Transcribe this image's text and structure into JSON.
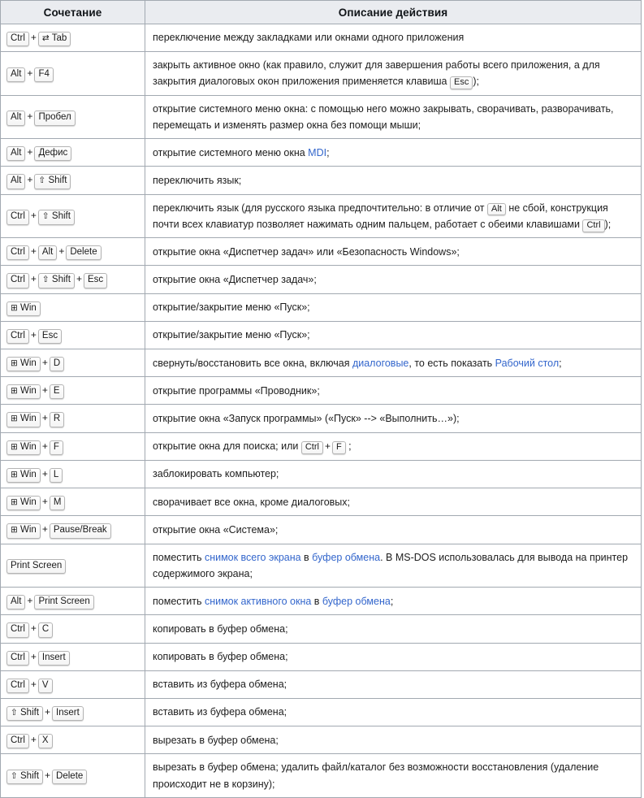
{
  "table": {
    "headers": {
      "combo": "Сочетание",
      "description": "Описание действия"
    },
    "colors": {
      "header_bg": "#eaecf0",
      "border": "#a2a9b1",
      "link": "#3366cc",
      "key_bg": "#fcfcfc",
      "text": "#1a1a1a"
    },
    "rows": [
      {
        "keys": [
          {
            "type": "kbd",
            "label": "Ctrl"
          },
          {
            "type": "plus",
            "label": "+"
          },
          {
            "type": "kbd",
            "label": "Tab",
            "glyph": "⇄"
          }
        ],
        "desc_parts": [
          {
            "type": "text",
            "text": "переключение между закладками или окнами одного приложения"
          }
        ]
      },
      {
        "keys": [
          {
            "type": "kbd",
            "label": "Alt"
          },
          {
            "type": "plus",
            "label": "+"
          },
          {
            "type": "kbd",
            "label": "F4"
          }
        ],
        "desc_parts": [
          {
            "type": "text",
            "text": "закрыть активное окно (как правило, служит для завершения работы всего приложения, а для закрытия диалоговых окон приложения применяется клавиша "
          },
          {
            "type": "kbd",
            "label": "Esc"
          },
          {
            "type": "text",
            "text": ");"
          }
        ]
      },
      {
        "keys": [
          {
            "type": "kbd",
            "label": "Alt"
          },
          {
            "type": "plus",
            "label": "+"
          },
          {
            "type": "kbd",
            "label": "Пробел"
          }
        ],
        "desc_parts": [
          {
            "type": "text",
            "text": "открытие системного меню окна: с помощью него можно закрывать, сворачивать, разворачивать, перемещать и изменять размер окна без помощи мыши;"
          }
        ]
      },
      {
        "keys": [
          {
            "type": "kbd",
            "label": "Alt"
          },
          {
            "type": "plus",
            "label": "+"
          },
          {
            "type": "kbd",
            "label": "Дефис"
          }
        ],
        "desc_parts": [
          {
            "type": "text",
            "text": "открытие системного меню окна "
          },
          {
            "type": "link",
            "text": "MDI"
          },
          {
            "type": "text",
            "text": ";"
          }
        ]
      },
      {
        "keys": [
          {
            "type": "kbd",
            "label": "Alt"
          },
          {
            "type": "plus",
            "label": "+"
          },
          {
            "type": "kbd",
            "label": "Shift",
            "glyph": "⇧"
          }
        ],
        "desc_parts": [
          {
            "type": "text",
            "text": "переключить язык;"
          }
        ]
      },
      {
        "keys": [
          {
            "type": "kbd",
            "label": "Ctrl"
          },
          {
            "type": "plus",
            "label": "+"
          },
          {
            "type": "kbd",
            "label": "Shift",
            "glyph": "⇧"
          }
        ],
        "desc_parts": [
          {
            "type": "text",
            "text": "переключить язык (для русского языка предпочтительно: в отличие от "
          },
          {
            "type": "kbd",
            "label": "Alt"
          },
          {
            "type": "text",
            "text": " не сбой, конструкция почти всех клавиатур позволяет нажимать одним пальцем, работает с обеими клавишами "
          },
          {
            "type": "kbd",
            "label": "Ctrl"
          },
          {
            "type": "text",
            "text": ");"
          }
        ]
      },
      {
        "keys": [
          {
            "type": "kbd",
            "label": "Ctrl"
          },
          {
            "type": "plus",
            "label": "+"
          },
          {
            "type": "kbd",
            "label": "Alt"
          },
          {
            "type": "plus",
            "label": "+"
          },
          {
            "type": "kbd",
            "label": "Delete"
          }
        ],
        "desc_parts": [
          {
            "type": "text",
            "text": "открытие окна «Диспетчер задач» или «Безопасность Windows»;"
          }
        ]
      },
      {
        "keys": [
          {
            "type": "kbd",
            "label": "Ctrl"
          },
          {
            "type": "plus",
            "label": "+"
          },
          {
            "type": "kbd",
            "label": "Shift",
            "glyph": "⇧"
          },
          {
            "type": "plus",
            "label": "+"
          },
          {
            "type": "kbd",
            "label": "Esc"
          }
        ],
        "desc_parts": [
          {
            "type": "text",
            "text": "открытие окна «Диспетчер задач»;"
          }
        ]
      },
      {
        "keys": [
          {
            "type": "kbd",
            "label": "Win",
            "glyph": "⊞"
          }
        ],
        "desc_parts": [
          {
            "type": "text",
            "text": "открытие/закрытие меню «Пуск»;"
          }
        ]
      },
      {
        "keys": [
          {
            "type": "kbd",
            "label": "Ctrl"
          },
          {
            "type": "plus",
            "label": "+"
          },
          {
            "type": "kbd",
            "label": "Esc"
          }
        ],
        "desc_parts": [
          {
            "type": "text",
            "text": "открытие/закрытие меню «Пуск»;"
          }
        ]
      },
      {
        "keys": [
          {
            "type": "kbd",
            "label": "Win",
            "glyph": "⊞"
          },
          {
            "type": "plus",
            "label": "+"
          },
          {
            "type": "kbd",
            "label": "D"
          }
        ],
        "desc_parts": [
          {
            "type": "text",
            "text": "свернуть/восстановить все окна, включая "
          },
          {
            "type": "link",
            "text": "диалоговые"
          },
          {
            "type": "text",
            "text": ", то есть показать "
          },
          {
            "type": "link",
            "text": "Рабочий стол"
          },
          {
            "type": "text",
            "text": ";"
          }
        ]
      },
      {
        "keys": [
          {
            "type": "kbd",
            "label": "Win",
            "glyph": "⊞"
          },
          {
            "type": "plus",
            "label": "+"
          },
          {
            "type": "kbd",
            "label": "E"
          }
        ],
        "desc_parts": [
          {
            "type": "text",
            "text": "открытие программы «Проводник»;"
          }
        ]
      },
      {
        "keys": [
          {
            "type": "kbd",
            "label": "Win",
            "glyph": "⊞"
          },
          {
            "type": "plus",
            "label": "+"
          },
          {
            "type": "kbd",
            "label": "R"
          }
        ],
        "desc_parts": [
          {
            "type": "text",
            "text": "открытие окна «Запуск программы» («Пуск» --> «Выполнить…»);"
          }
        ]
      },
      {
        "keys": [
          {
            "type": "kbd",
            "label": "Win",
            "glyph": "⊞"
          },
          {
            "type": "plus",
            "label": "+"
          },
          {
            "type": "kbd",
            "label": "F"
          }
        ],
        "desc_parts": [
          {
            "type": "text",
            "text": "открытие окна для поиска; или "
          },
          {
            "type": "kbd",
            "label": "Ctrl"
          },
          {
            "type": "plustext",
            "text": "+"
          },
          {
            "type": "kbd",
            "label": "F"
          },
          {
            "type": "text",
            "text": " ;"
          }
        ]
      },
      {
        "keys": [
          {
            "type": "kbd",
            "label": "Win",
            "glyph": "⊞"
          },
          {
            "type": "plus",
            "label": "+"
          },
          {
            "type": "kbd",
            "label": "L"
          }
        ],
        "desc_parts": [
          {
            "type": "text",
            "text": "заблокировать компьютер;"
          }
        ]
      },
      {
        "keys": [
          {
            "type": "kbd",
            "label": "Win",
            "glyph": "⊞"
          },
          {
            "type": "plus",
            "label": "+"
          },
          {
            "type": "kbd",
            "label": "M"
          }
        ],
        "desc_parts": [
          {
            "type": "text",
            "text": "сворачивает все окна, кроме диалоговых;"
          }
        ]
      },
      {
        "keys": [
          {
            "type": "kbd",
            "label": "Win",
            "glyph": "⊞"
          },
          {
            "type": "plus",
            "label": "+"
          },
          {
            "type": "kbd",
            "label": "Pause/Break"
          }
        ],
        "desc_parts": [
          {
            "type": "text",
            "text": "открытие окна «Система»;"
          }
        ]
      },
      {
        "keys": [
          {
            "type": "kbd",
            "label": "Print Screen"
          }
        ],
        "desc_parts": [
          {
            "type": "text",
            "text": "поместить "
          },
          {
            "type": "link",
            "text": "снимок всего экрана"
          },
          {
            "type": "text",
            "text": " в "
          },
          {
            "type": "link",
            "text": "буфер обмена"
          },
          {
            "type": "text",
            "text": ". В MS-DOS использовалась для вывода на принтер содержимого экрана;"
          }
        ]
      },
      {
        "keys": [
          {
            "type": "kbd",
            "label": "Alt"
          },
          {
            "type": "plus",
            "label": "+"
          },
          {
            "type": "kbd",
            "label": "Print Screen"
          }
        ],
        "desc_parts": [
          {
            "type": "text",
            "text": "поместить "
          },
          {
            "type": "link",
            "text": "снимок активного окна"
          },
          {
            "type": "text",
            "text": " в "
          },
          {
            "type": "link",
            "text": "буфер обмена"
          },
          {
            "type": "text",
            "text": ";"
          }
        ]
      },
      {
        "keys": [
          {
            "type": "kbd",
            "label": "Ctrl"
          },
          {
            "type": "plus",
            "label": "+"
          },
          {
            "type": "kbd",
            "label": "C"
          }
        ],
        "desc_parts": [
          {
            "type": "text",
            "text": "копировать в буфер обмена;"
          }
        ]
      },
      {
        "keys": [
          {
            "type": "kbd",
            "label": "Ctrl"
          },
          {
            "type": "plus",
            "label": "+"
          },
          {
            "type": "kbd",
            "label": "Insert"
          }
        ],
        "desc_parts": [
          {
            "type": "text",
            "text": "копировать в буфер обмена;"
          }
        ]
      },
      {
        "keys": [
          {
            "type": "kbd",
            "label": "Ctrl"
          },
          {
            "type": "plus",
            "label": "+"
          },
          {
            "type": "kbd",
            "label": "V"
          }
        ],
        "desc_parts": [
          {
            "type": "text",
            "text": "вставить из буфера обмена;"
          }
        ]
      },
      {
        "keys": [
          {
            "type": "kbd",
            "label": "Shift",
            "glyph": "⇧"
          },
          {
            "type": "plus",
            "label": "+"
          },
          {
            "type": "kbd",
            "label": "Insert"
          }
        ],
        "desc_parts": [
          {
            "type": "text",
            "text": "вставить из буфера обмена;"
          }
        ]
      },
      {
        "keys": [
          {
            "type": "kbd",
            "label": "Ctrl"
          },
          {
            "type": "plus",
            "label": "+"
          },
          {
            "type": "kbd",
            "label": "X"
          }
        ],
        "desc_parts": [
          {
            "type": "text",
            "text": "вырезать в буфер обмена;"
          }
        ]
      },
      {
        "keys": [
          {
            "type": "kbd",
            "label": "Shift",
            "glyph": "⇧"
          },
          {
            "type": "plus",
            "label": "+"
          },
          {
            "type": "kbd",
            "label": "Delete"
          }
        ],
        "desc_parts": [
          {
            "type": "text",
            "text": "вырезать в буфер обмена; удалить файл/каталог без возможности восстановления (удаление происходит не в корзину);"
          }
        ]
      }
    ]
  }
}
